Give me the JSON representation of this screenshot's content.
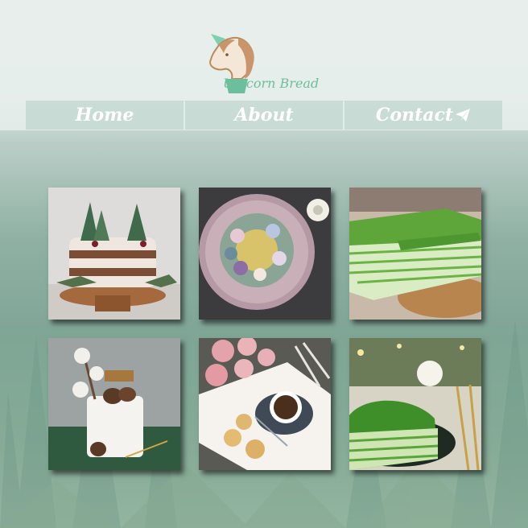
{
  "brand": {
    "name": "Unicorn Bread",
    "logo_icon": "unicorn-head-icon",
    "accent_color": "#6cbf9c"
  },
  "nav": {
    "items": [
      {
        "label": "Home"
      },
      {
        "label": "About"
      },
      {
        "label": "Contact",
        "icon": "paper-plane-icon"
      }
    ]
  },
  "gallery": {
    "items": [
      {
        "subject": "naked-cake-with-pine-trees"
      },
      {
        "subject": "flower-wreath-cake"
      },
      {
        "subject": "matcha-crepe-cake"
      },
      {
        "subject": "cotton-pinecone-cake"
      },
      {
        "subject": "flowers-coffee-cookies"
      },
      {
        "subject": "matcha-crepe-slice"
      }
    ]
  }
}
